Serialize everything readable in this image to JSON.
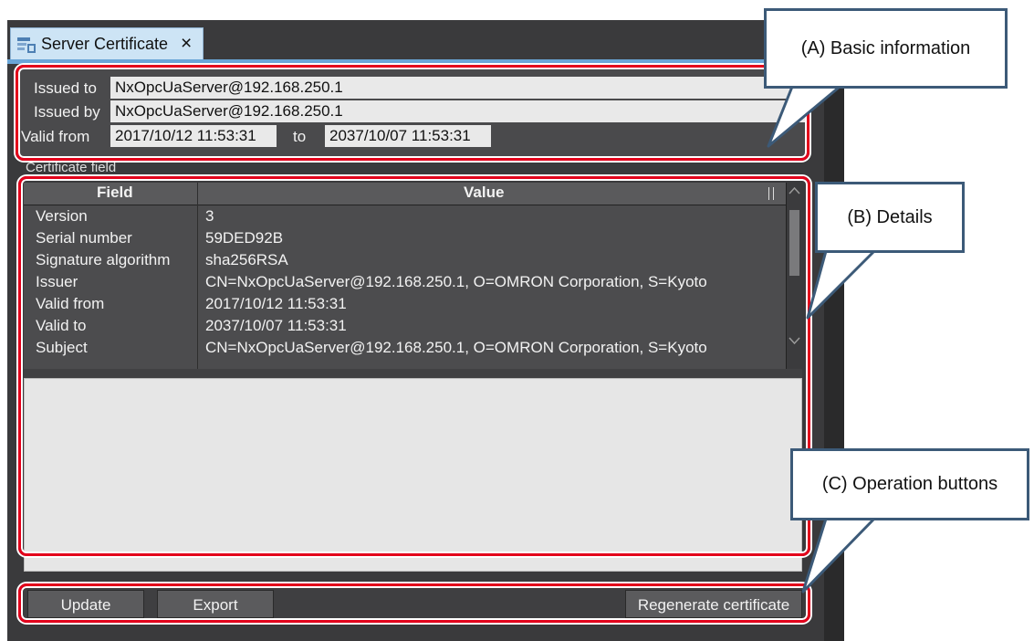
{
  "tab": {
    "title": "Server Certificate",
    "close": "×"
  },
  "basic_info": {
    "issued_to_label": "Issued to",
    "issued_to_value": "NxOpcUaServer@192.168.250.1",
    "issued_by_label": "Issued by",
    "issued_by_value": "NxOpcUaServer@192.168.250.1",
    "valid_from_label": "Valid from",
    "valid_from_value": "2017/10/12 11:53:31",
    "to_label": "to",
    "valid_to_value": "2037/10/07 11:53:31"
  },
  "certificate_field": {
    "label": "Certificate field",
    "columns": [
      "Field",
      "Value"
    ],
    "rows": [
      [
        "Version",
        "3"
      ],
      [
        "Serial number",
        "59DED92B"
      ],
      [
        "Signature algorithm",
        "sha256RSA"
      ],
      [
        "Issuer",
        "CN=NxOpcUaServer@192.168.250.1, O=OMRON Corporation, S=Kyoto"
      ],
      [
        "Valid from",
        "2017/10/12 11:53:31"
      ],
      [
        "Valid to",
        "2037/10/07 11:53:31"
      ],
      [
        "Subject",
        "CN=NxOpcUaServer@192.168.250.1, O=OMRON Corporation, S=Kyoto"
      ]
    ]
  },
  "buttons": {
    "update": "Update",
    "export": "Export",
    "regenerate": "Regenerate certificate"
  },
  "callouts": {
    "a": "(A) Basic information",
    "b": "(B) Details",
    "c": "(C) Operation buttons"
  },
  "colors": {
    "highlight": "#e3001b",
    "callout_border": "#3c5a78",
    "tab_accent": "#6aa6d8"
  }
}
